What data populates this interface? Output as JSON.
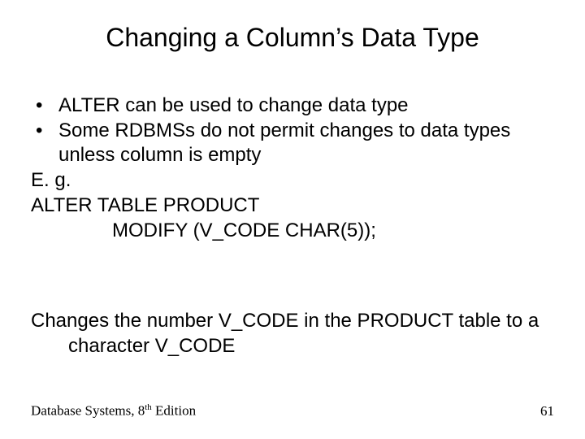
{
  "title": "Changing a Column’s Data Type",
  "bullets": {
    "b1": "ALTER can be used to change data type",
    "b2": "Some RDBMSs do not permit changes to data types unless column is empty"
  },
  "lines": {
    "eg": "E. g.",
    "sql1": "ALTER TABLE PRODUCT",
    "sql2": "MODIFY (V_CODE CHAR(5));"
  },
  "para": "Changes the number V_CODE in the PRODUCT table to a character V_CODE",
  "footer": {
    "left_pre": "Database Systems, 8",
    "left_sup": "th",
    "left_post": " Edition",
    "page": "61"
  }
}
